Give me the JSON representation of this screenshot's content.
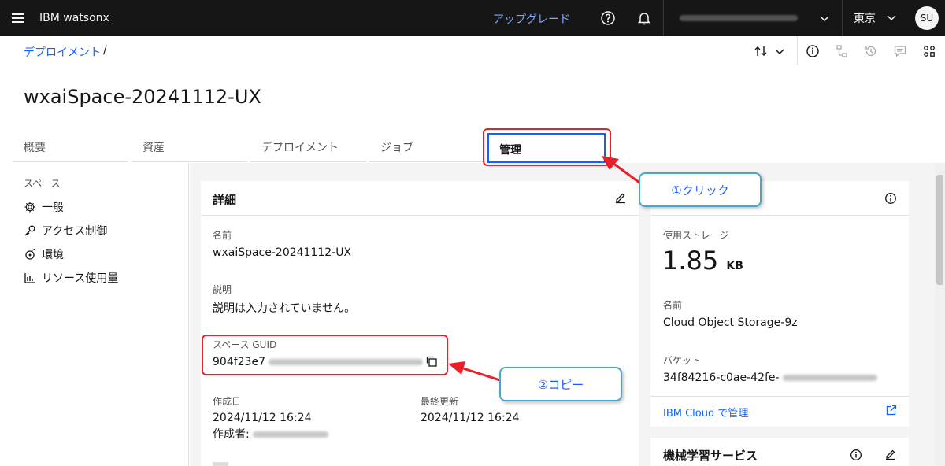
{
  "topbar": {
    "brand": "IBM watsonx",
    "upgrade": "アップグレード",
    "region": "東京",
    "avatar": "SU"
  },
  "breadcrumb": {
    "link": "デプロイメント",
    "separator": "/"
  },
  "page": {
    "title": "wxaiSpace-20241112-UX"
  },
  "tabs": [
    {
      "label": "概要"
    },
    {
      "label": "資産"
    },
    {
      "label": "デプロイメント"
    },
    {
      "label": "ジョブ"
    },
    {
      "label": "管理"
    }
  ],
  "sidenav": {
    "heading": "スペース",
    "items": [
      {
        "label": "一般",
        "icon": "gear-icon"
      },
      {
        "label": "アクセス制御",
        "icon": "key-icon"
      },
      {
        "label": "環境",
        "icon": "environment-icon"
      },
      {
        "label": "リソース使用量",
        "icon": "chart-icon"
      }
    ]
  },
  "details": {
    "title": "詳細",
    "name_label": "名前",
    "name_value": "wxaiSpace-20241112-UX",
    "desc_label": "説明",
    "desc_value": "説明は入力されていません。",
    "guid_label": "スペース GUID",
    "guid_value": "904f23e7",
    "created_label": "作成日",
    "created_value": "2024/11/12 16:24",
    "creator_label": "作成者:",
    "updated_label": "最終更新",
    "updated_value": "2024/11/12 16:24"
  },
  "storage": {
    "usage_label": "使用ストレージ",
    "usage_value": "1.85",
    "usage_unit": "KB",
    "name_label": "名前",
    "name_value": "Cloud Object Storage-9z",
    "bucket_label": "バケット",
    "bucket_value": "34f84216-c0ae-42fe-",
    "manage_link": "IBM Cloud で管理"
  },
  "ml_service": {
    "title": "機械学習サービス"
  },
  "annotations": {
    "click": "①クリック",
    "copy": "②コピー"
  },
  "colors": {
    "accent": "#0f62fe",
    "annotation_red": "#e8202a",
    "callout_border": "#46a8c8"
  }
}
